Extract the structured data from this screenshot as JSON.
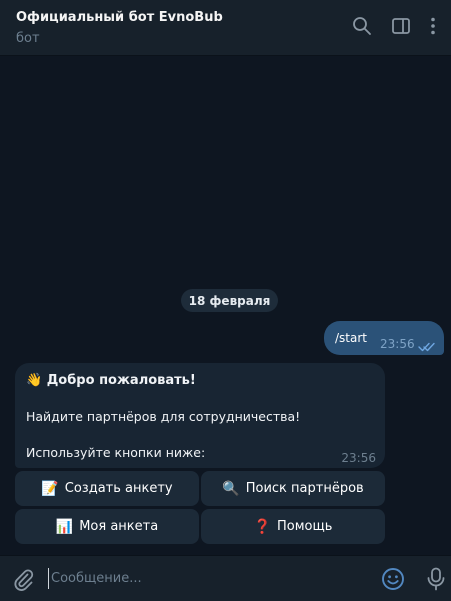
{
  "header": {
    "title": "Официальный бот EvnoBub",
    "subtitle": "бот",
    "icons": [
      "search-icon",
      "sidebar-toggle-icon",
      "more-vertical-icon"
    ]
  },
  "date_divider": "18 февраля",
  "outgoing": {
    "text": "/start",
    "time": "23:56",
    "status_icon": "double-check-icon"
  },
  "incoming": {
    "greeting_emoji": "👋",
    "greeting": "Добро пожаловать!",
    "line2": "Найдите партнёров для сотрудничества!",
    "line3": "Используйте кнопки ниже:",
    "time": "23:56"
  },
  "keyboard": [
    {
      "emoji": "📝",
      "label": "Создать анкету"
    },
    {
      "emoji": "🔍",
      "label": "Поиск партнёров"
    },
    {
      "emoji": "📊",
      "label": "Моя анкета"
    },
    {
      "emoji": "❓",
      "label": "Помощь"
    }
  ],
  "composer": {
    "placeholder": "Сообщение...",
    "value": "",
    "icons": [
      "paperclip-icon",
      "emoji-icon",
      "microphone-icon"
    ]
  },
  "colors": {
    "background": "#0e1621",
    "header": "#17212b",
    "outgoing_bubble": "#2b5278",
    "incoming_bubble": "#182533",
    "keyboard_button": "#1c2a38",
    "accent": "#5288c1"
  }
}
